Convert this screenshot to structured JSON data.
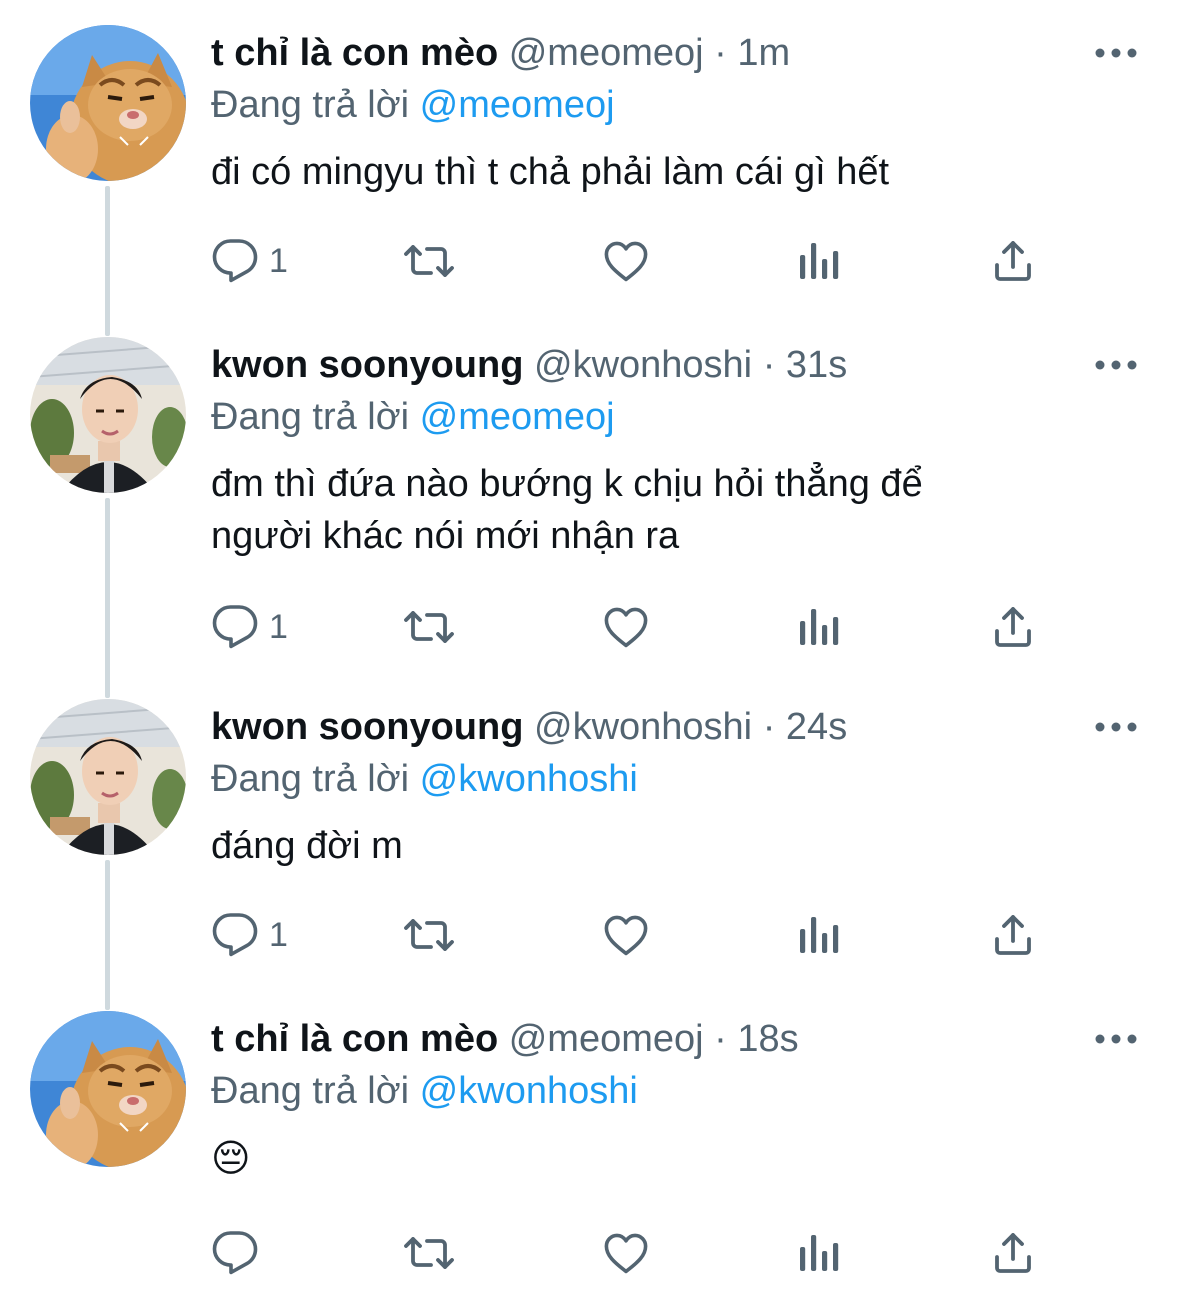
{
  "colors": {
    "text": "#0f1419",
    "secondary": "#536471",
    "link": "#1d9bf0",
    "thread_line": "#cfd9de"
  },
  "labels": {
    "separator": "·",
    "replying_to": "Đang trả lời"
  },
  "tweets": [
    {
      "avatar": "cat-avatar",
      "display_name": "t chỉ là con mèo",
      "handle": "@meomeoj",
      "time": "1m",
      "reply_to": "@meomeoj",
      "lines": [
        "đi có mingyu thì t chả phải làm cái gì hết"
      ],
      "reply_count": "1"
    },
    {
      "avatar": "person-avatar",
      "display_name": "kwon soonyoung",
      "handle": "@kwonhoshi",
      "time": "31s",
      "reply_to": "@meomeoj",
      "lines": [
        "đm thì đứa nào bướng k chịu hỏi thẳng để",
        "người khác nói mới nhận ra"
      ],
      "reply_count": "1"
    },
    {
      "avatar": "person-avatar",
      "display_name": "kwon soonyoung",
      "handle": "@kwonhoshi",
      "time": "24s",
      "reply_to": "@kwonhoshi",
      "lines": [
        "đáng đời m"
      ],
      "reply_count": "1"
    },
    {
      "avatar": "cat-avatar",
      "display_name": "t chỉ là con mèo",
      "handle": "@meomeoj",
      "time": "18s",
      "reply_to": "@kwonhoshi",
      "lines": [
        "😔"
      ],
      "reply_count": ""
    }
  ]
}
